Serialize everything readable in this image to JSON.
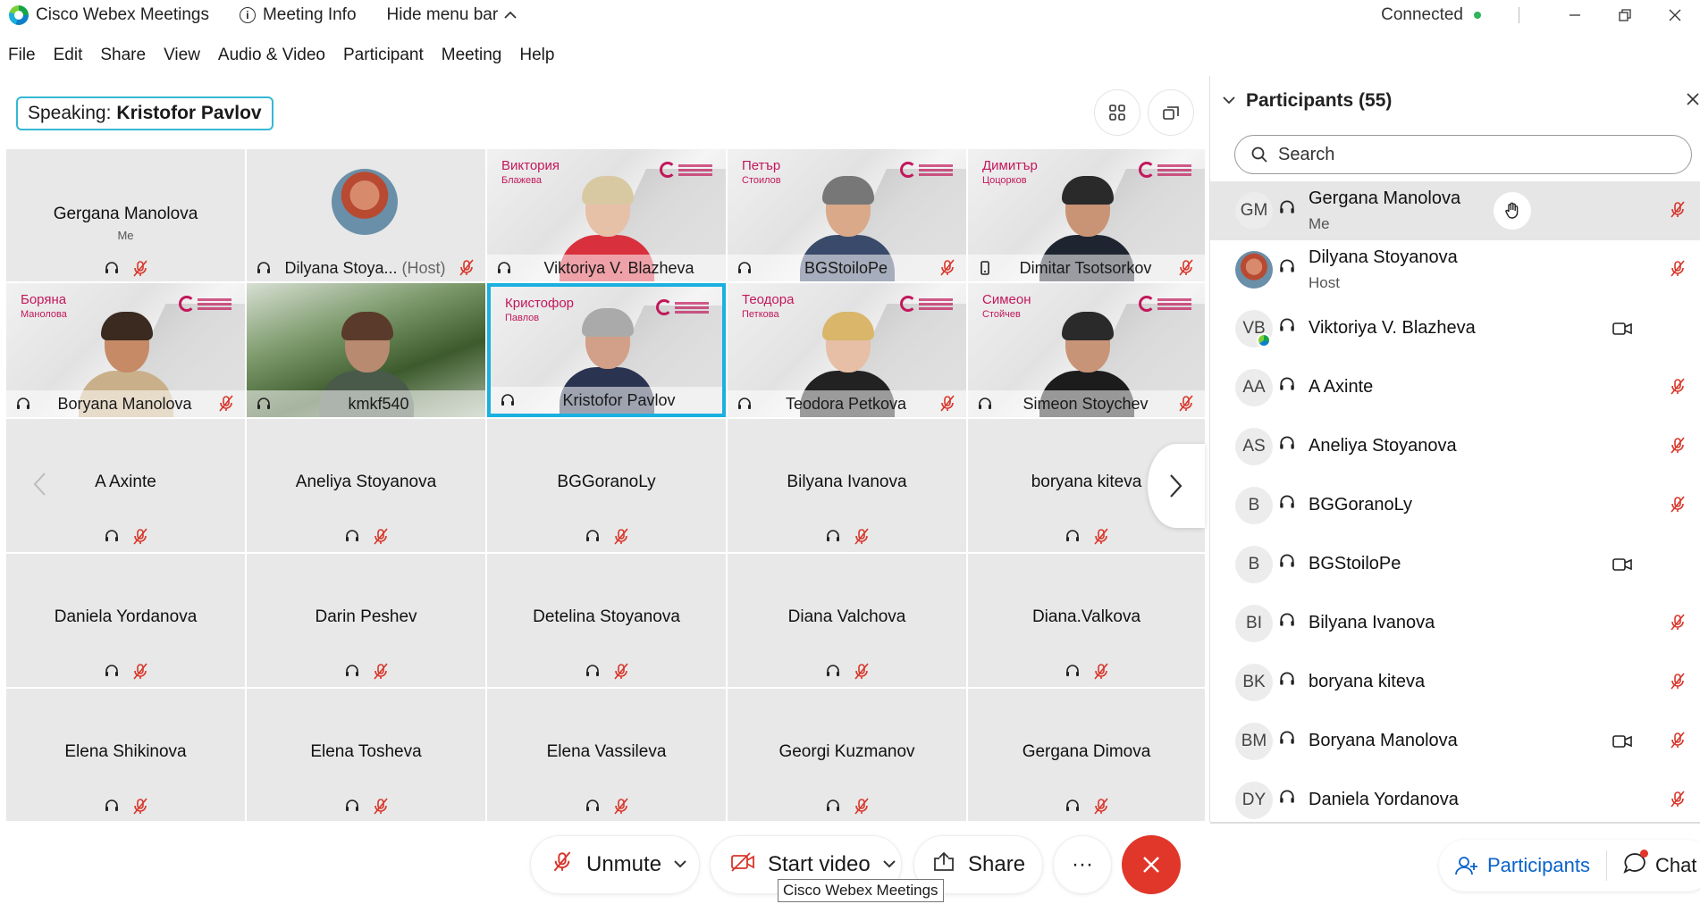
{
  "titlebar": {
    "app_name": "Cisco Webex Meetings",
    "meeting_info": "Meeting Info",
    "hide_menu": "Hide menu bar",
    "status": "Connected"
  },
  "menu": [
    "File",
    "Edit",
    "Share",
    "View",
    "Audio & Video",
    "Participant",
    "Meeting",
    "Help"
  ],
  "speaking": {
    "label": "Speaking:",
    "name": "Kristofor Pavlov"
  },
  "tiles_row1": [
    {
      "name": "Gergana Manolova",
      "sub": "Me"
    },
    {
      "name": "Dilyana Stoya...",
      "host": "(Host)"
    },
    {
      "name": "Viktoriya V. Blazheva",
      "overlay": "Виктория",
      "overlay2": "Блажева"
    },
    {
      "name": "BGStoiloPe",
      "overlay": "Петър",
      "overlay2": "Стоилов"
    },
    {
      "name": "Dimitar Tsotsorkov",
      "overlay": "Димитър",
      "overlay2": "Цоцорков"
    }
  ],
  "tiles_row2": [
    {
      "name": "Boryana Manolova",
      "overlay": "Боряна",
      "overlay2": "Манолова"
    },
    {
      "name": "kmkf540"
    },
    {
      "name": "Kristofor Pavlov",
      "overlay": "Кристофор",
      "overlay2": "Павлов"
    },
    {
      "name": "Teodora Petkova",
      "overlay": "Теодора",
      "overlay2": "Петкова"
    },
    {
      "name": "Simeon Stoychev",
      "overlay": "Симеон",
      "overlay2": "Стойчев"
    }
  ],
  "tiles_row3": [
    "A Axinte",
    "Aneliya Stoyanova",
    "BGGoranoLy",
    "Bilyana Ivanova",
    "boryana kiteva"
  ],
  "tiles_row4": [
    "Daniela Yordanova",
    "Darin Peshev",
    "Detelina Stoyanova",
    "Diana Valchova",
    "Diana.Valkova"
  ],
  "tiles_row5": [
    "Elena Shikinova",
    "Elena Tosheva",
    "Elena Vassileva",
    "Georgi Kuzmanov",
    "Gergana Dimova"
  ],
  "controls": {
    "unmute": "Unmute",
    "start_video": "Start video",
    "share": "Share",
    "more": "···",
    "tooltip": "Cisco Webex Meetings"
  },
  "panel": {
    "title": "Participants (55)",
    "search_placeholder": "Search",
    "participants": [
      {
        "initials": "GM",
        "name": "Gergana Manolova",
        "sub": "Me",
        "video": false,
        "selected": true
      },
      {
        "initials": "",
        "name": "Dilyana Stoyanova",
        "sub": "Host",
        "video": false
      },
      {
        "initials": "VB",
        "name": "Viktoriya V. Blazheva",
        "sub": "",
        "video": true
      },
      {
        "initials": "AA",
        "name": "A Axinte",
        "sub": "",
        "video": false
      },
      {
        "initials": "AS",
        "name": "Aneliya Stoyanova",
        "sub": "",
        "video": false
      },
      {
        "initials": "B",
        "name": "BGGoranoLy",
        "sub": "",
        "video": false
      },
      {
        "initials": "B",
        "name": "BGStoiloPe",
        "sub": "",
        "video": true
      },
      {
        "initials": "BI",
        "name": "Bilyana Ivanova",
        "sub": "",
        "video": false
      },
      {
        "initials": "BK",
        "name": "boryana kiteva",
        "sub": "",
        "video": false
      },
      {
        "initials": "BM",
        "name": "Boryana Manolova",
        "sub": "",
        "video": true
      },
      {
        "initials": "DY",
        "name": "Daniela Yordanova",
        "sub": "",
        "video": false
      }
    ]
  },
  "tabs": {
    "participants": "Participants",
    "chat": "Chat"
  }
}
